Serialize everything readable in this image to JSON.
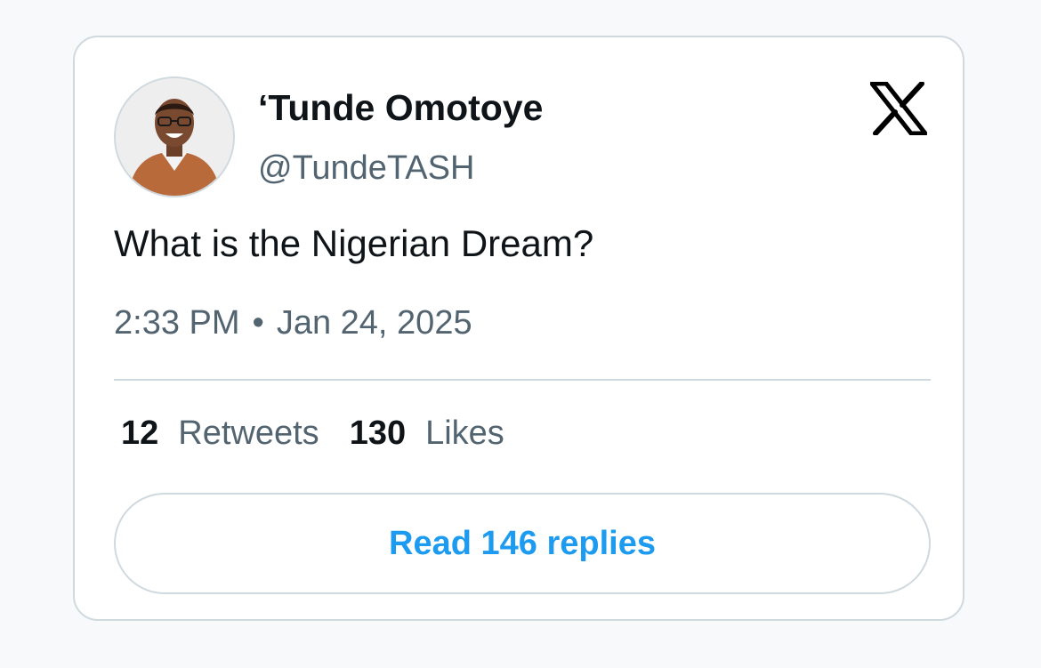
{
  "author": {
    "name": "‘Tunde Omotoye",
    "handle": "@TundeTASH"
  },
  "tweet": {
    "text": "What is the Nigerian Dream?",
    "time": "2:33 PM",
    "separator": "•",
    "date": "Jan 24, 2025"
  },
  "stats": {
    "retweets_count": "12",
    "retweets_label": "Retweets",
    "likes_count": "130",
    "likes_label": "Likes"
  },
  "read_replies_label": "Read 146 replies",
  "icons": {
    "brand": "x-logo-icon",
    "avatar": "profile-photo"
  },
  "colors": {
    "text_primary": "#0f1419",
    "text_secondary": "#536471",
    "accent": "#1d9bf0",
    "border": "#cfd9de"
  }
}
